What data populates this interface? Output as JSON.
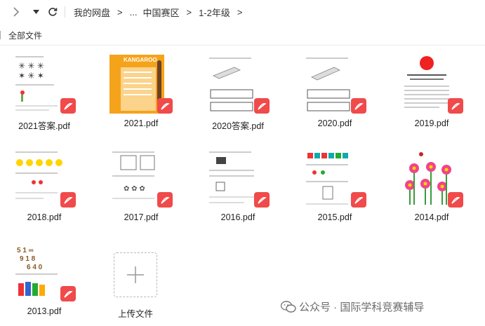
{
  "breadcrumb": {
    "items": [
      "我的网盘",
      "...",
      "中国赛区",
      "1-2年级"
    ],
    "separator": ">"
  },
  "subheader": {
    "label": "全部文件"
  },
  "files": [
    {
      "name": "2021答案.pdf",
      "icon": "pdf-icon",
      "thumb": "stars"
    },
    {
      "name": "2021.pdf",
      "icon": "pdf-icon",
      "thumb": "kangaroo-cover"
    },
    {
      "name": "2020答案.pdf",
      "icon": "pdf-icon",
      "thumb": "snake"
    },
    {
      "name": "2020.pdf",
      "icon": "pdf-icon",
      "thumb": "snake"
    },
    {
      "name": "2019.pdf",
      "icon": "pdf-icon",
      "thumb": "hk-doc"
    },
    {
      "name": "2018.pdf",
      "icon": "pdf-icon",
      "thumb": "smileys"
    },
    {
      "name": "2017.pdf",
      "icon": "pdf-icon",
      "thumb": "maze"
    },
    {
      "name": "2016.pdf",
      "icon": "pdf-icon",
      "thumb": "blocks"
    },
    {
      "name": "2015.pdf",
      "icon": "pdf-icon",
      "thumb": "color-blocks"
    },
    {
      "name": "2014.pdf",
      "icon": "pdf-icon",
      "thumb": "flowers"
    },
    {
      "name": "2013.pdf",
      "icon": "pdf-icon",
      "thumb": "numbers"
    }
  ],
  "upload": {
    "label": "上传文件",
    "icon": "plus-icon"
  },
  "watermark": {
    "text": "公众号 · 国际学科竞赛辅导",
    "icon": "wechat-icon"
  },
  "colors": {
    "pdf_badge": "#f04a4a",
    "kangaroo_orange": "#f5a31a",
    "flower_pink": "#f0448a"
  }
}
